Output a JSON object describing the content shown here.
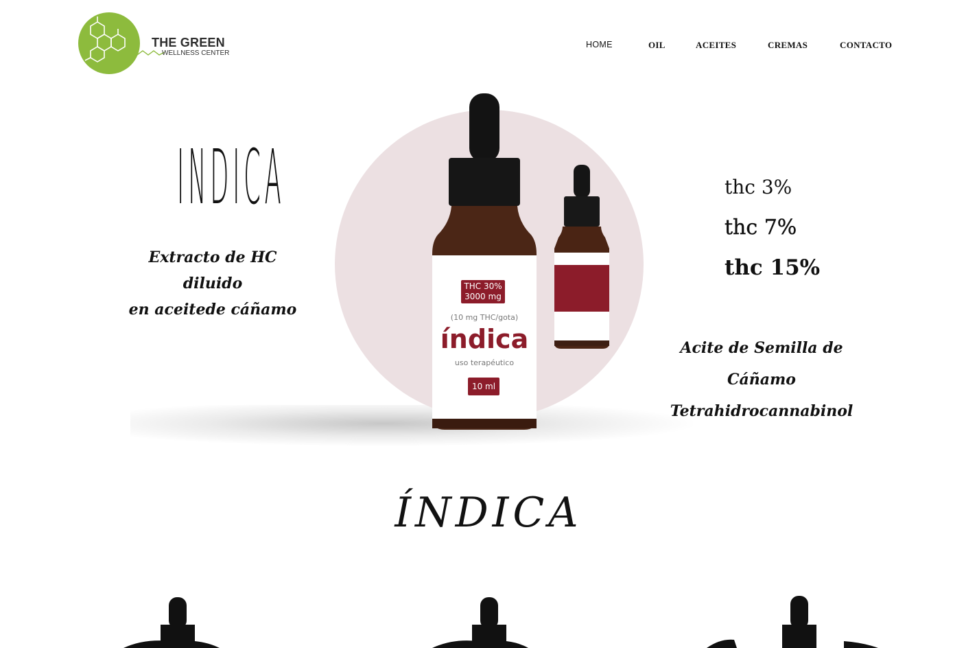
{
  "brand": {
    "name": "THE GREEN",
    "subtitle": "WELLNESS CENTER",
    "logo_color": "#8dbb3d"
  },
  "nav": {
    "items": [
      "HOME",
      "OIL",
      "ACEITES",
      "CREMAS",
      "CONTACTO"
    ]
  },
  "hero": {
    "title": "INDICA",
    "description_line1": "Extracto de HC diluido",
    "description_line2": "en aceitede cáñamo",
    "thc_options": [
      "thc 3%",
      "thc 7%",
      "thc 15%"
    ],
    "ingredients_line1": "Acite de Semilla de Cáñamo",
    "ingredients_line2": "Tetrahidrocannabinol",
    "circle_color": "#ece0e2"
  },
  "product_label": {
    "badge_line1": "THC 30%",
    "badge_line2": "3000 mg",
    "dose": "(10 mg THC/gota)",
    "name": "índica",
    "use": "uso terapéutico",
    "volume": "10 ml",
    "accent_color": "#8c1c2a"
  },
  "section": {
    "title": "ÍNDICA"
  }
}
